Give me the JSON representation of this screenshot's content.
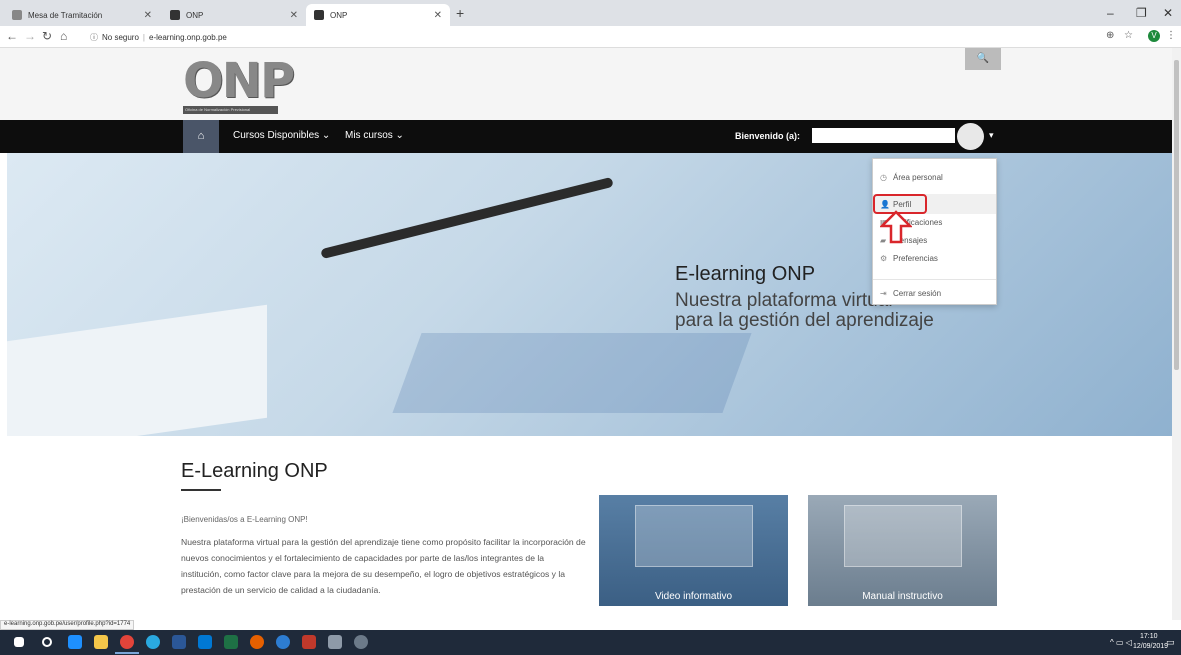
{
  "browser": {
    "tabs": [
      {
        "title": "Mesa de Tramitación",
        "active": false
      },
      {
        "title": "ONP",
        "active": false
      },
      {
        "title": "ONP",
        "active": true
      }
    ],
    "new_tab": "+",
    "address": {
      "security": "No seguro",
      "url": "e-learning.onp.gob.pe"
    },
    "profile_initial": "V"
  },
  "header": {
    "logo_text": "ONP",
    "logo_subtitle": "Oficina de Normalización Previsional"
  },
  "navbar": {
    "items": [
      {
        "label": "Cursos Disponibles ⌄"
      },
      {
        "label": "Mis cursos ⌄"
      }
    ],
    "welcome": "Bienvenido (a):"
  },
  "dropdown": {
    "items": [
      {
        "label": "Área personal",
        "icon": "dashboard-icon"
      },
      {
        "label": "Perfil",
        "icon": "user-icon"
      },
      {
        "label": "Calificaciones",
        "icon": "grades-icon"
      },
      {
        "label": "Mensajes",
        "icon": "messages-icon"
      },
      {
        "label": "Preferencias",
        "icon": "gear-icon"
      },
      {
        "label": "Cerrar sesión",
        "icon": "logout-icon"
      }
    ]
  },
  "hero": {
    "title": "E-learning ONP",
    "subtitle_line1": "Nuestra plataforma virtual",
    "subtitle_line2": "para la gestión del aprendizaje"
  },
  "content": {
    "title": "E-Learning ONP",
    "welcome": "¡Bienvenidas/os a E-Learning ONP!",
    "paragraph": "Nuestra plataforma virtual para la gestión del aprendizaje tiene como propósito facilitar la incorporación de nuevos conocimientos y el fortalecimiento de capacidades por parte de las/los integrantes de la institución, como factor clave para la mejora de su desempeño, el logro de objetivos estratégicos y la prestación de un servicio de calidad a la ciudadanía."
  },
  "cards": [
    {
      "label": "Video informativo"
    },
    {
      "label": "Manual instructivo"
    }
  ],
  "status_url": "e-learning.onp.gob.pe/user/profile.php?id=1774",
  "taskbar": {
    "time": "17:10",
    "date": "12/09/2019"
  },
  "colors": {
    "navbar": "#0d0d0d",
    "home_button": "#4a5568",
    "highlight": "#d9262b"
  }
}
